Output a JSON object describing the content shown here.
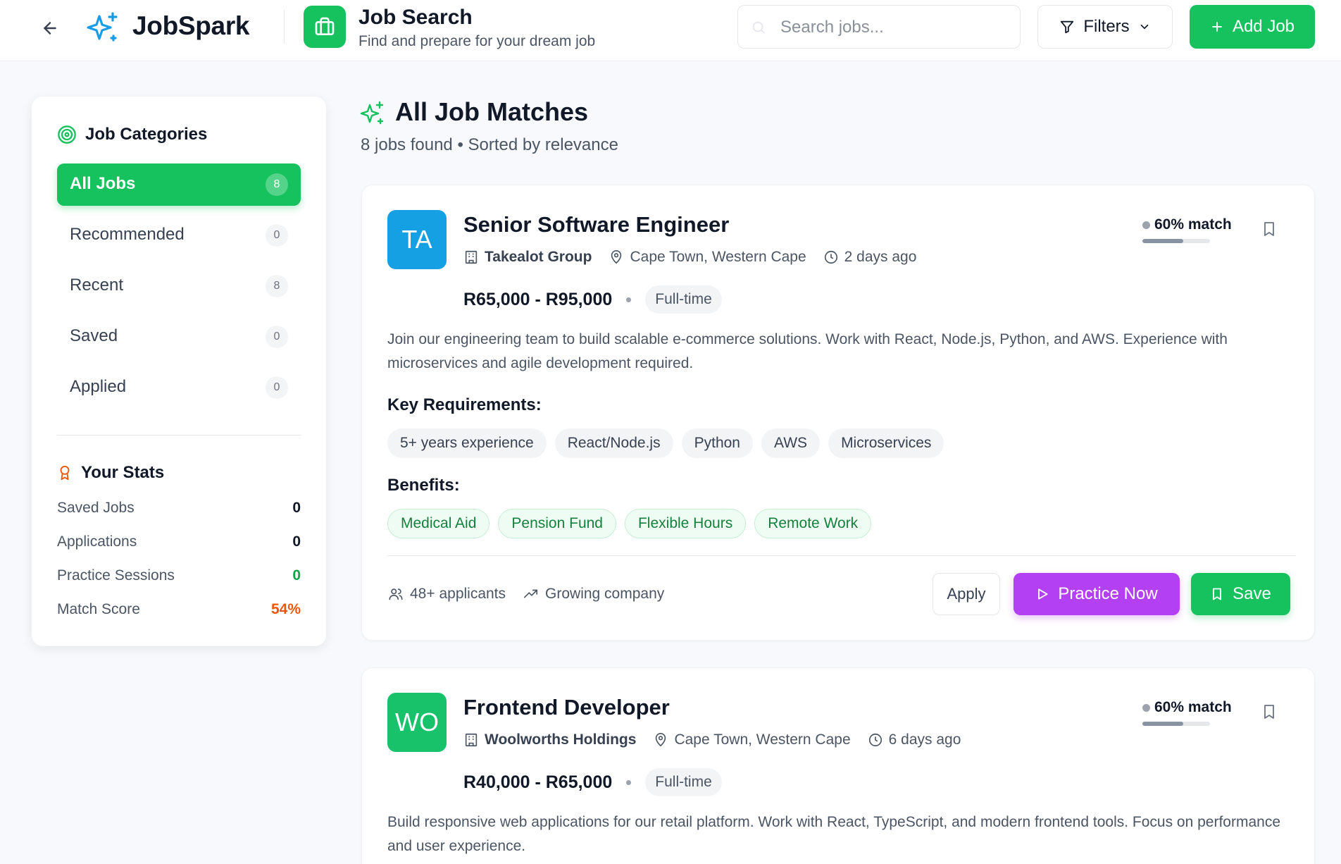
{
  "header": {
    "app_name": "JobSpark",
    "page_title": "Job Search",
    "page_subtitle": "Find and prepare for your dream job",
    "search_placeholder": "Search jobs...",
    "filters_label": "Filters",
    "add_job_label": "Add Job"
  },
  "colors": {
    "brand_green": "#16c25d",
    "practice_purple": "#b340f3",
    "logo_blue": "#1a9be6",
    "match_score_orange": "#ea580c"
  },
  "sidebar": {
    "categories_title": "Job Categories",
    "categories": [
      {
        "label": "All Jobs",
        "count": "8",
        "active": true
      },
      {
        "label": "Recommended",
        "count": "0",
        "active": false
      },
      {
        "label": "Recent",
        "count": "8",
        "active": false
      },
      {
        "label": "Saved",
        "count": "0",
        "active": false
      },
      {
        "label": "Applied",
        "count": "0",
        "active": false
      }
    ],
    "stats_title": "Your Stats",
    "stats": [
      {
        "label": "Saved Jobs",
        "value": "0",
        "color": "#111827"
      },
      {
        "label": "Applications",
        "value": "0",
        "color": "#111827"
      },
      {
        "label": "Practice Sessions",
        "value": "0",
        "color": "#16a34a"
      },
      {
        "label": "Match Score",
        "value": "54%",
        "color": "#ea580c"
      }
    ]
  },
  "main": {
    "title": "All Job Matches",
    "subtitle": "8 jobs found • Sorted by relevance",
    "jobs": [
      {
        "initials": "TA",
        "avatar_color": "#14a0e3",
        "title": "Senior Software Engineer",
        "company": "Takealot Group",
        "location": "Cape Town, Western Cape",
        "posted": "2 days ago",
        "salary": "R65,000 - R95,000",
        "type": "Full-time",
        "match_label": "60% match",
        "match_fraction": 0.6,
        "description": "Join our engineering team to build scalable e-commerce solutions. Work with React, Node.js, Python, and AWS. Experience with microservices and agile development required.",
        "requirements_label": "Key Requirements:",
        "requirements": [
          "5+ years experience",
          "React/Node.js",
          "Python",
          "AWS",
          "Microservices"
        ],
        "benefits_label": "Benefits:",
        "benefits": [
          "Medical Aid",
          "Pension Fund",
          "Flexible Hours",
          "Remote Work"
        ],
        "applicants": "48+ applicants",
        "growth": "Growing company",
        "apply_label": "Apply",
        "practice_label": "Practice Now",
        "save_label": "Save"
      },
      {
        "initials": "WO",
        "avatar_color": "#17c26b",
        "title": "Frontend Developer",
        "company": "Woolworths Holdings",
        "location": "Cape Town, Western Cape",
        "posted": "6 days ago",
        "salary": "R40,000 - R65,000",
        "type": "Full-time",
        "match_label": "60% match",
        "match_fraction": 0.6,
        "description": "Build responsive web applications for our retail platform. Work with React, TypeScript, and modern frontend tools. Focus on performance and user experience."
      }
    ]
  }
}
